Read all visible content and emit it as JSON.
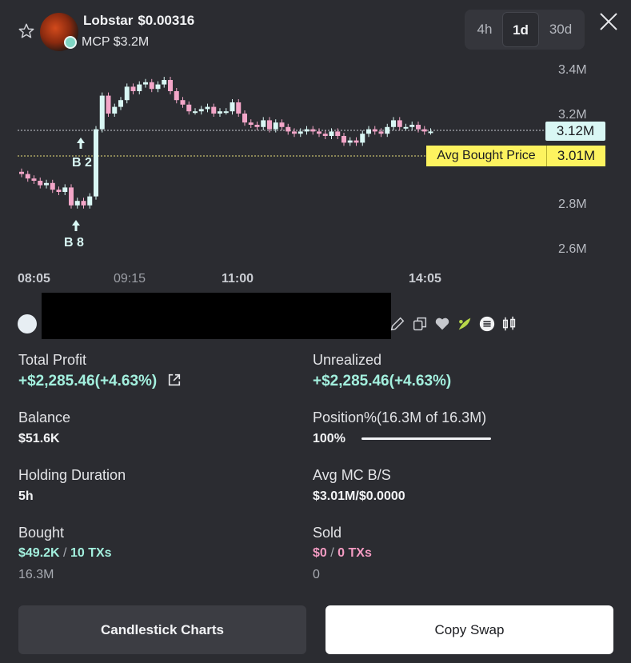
{
  "header": {
    "token_name": "Lobstar",
    "price": "$0.00316",
    "mcp": "MCP $3.2M",
    "timeframes": [
      "4h",
      "1d",
      "30d"
    ],
    "active_timeframe": "1d"
  },
  "chart_data": {
    "type": "candlestick",
    "y_ticks": [
      "3.4M",
      "3.2M",
      "2.8M",
      "2.6M"
    ],
    "x_ticks": [
      "08:05",
      "09:15",
      "11:00",
      "14:05"
    ],
    "current_price_label": "3.12M",
    "avg_bought_label": "Avg Bought Price",
    "avg_bought_value": "3.01M",
    "markers": [
      {
        "text": "B 8",
        "time": "08:55"
      },
      {
        "text": "B 2",
        "time": "09:00"
      }
    ],
    "up_color": "#d9f7f4",
    "down_color": "#f3a6c8",
    "closes_m": [
      2.93,
      2.91,
      2.9,
      2.88,
      2.89,
      2.86,
      2.85,
      2.87,
      2.79,
      2.81,
      2.79,
      2.83,
      3.13,
      3.28,
      3.2,
      3.23,
      3.26,
      3.32,
      3.3,
      3.33,
      3.34,
      3.31,
      3.33,
      3.35,
      3.3,
      3.26,
      3.24,
      3.21,
      3.21,
      3.22,
      3.23,
      3.2,
      3.21,
      3.21,
      3.25,
      3.2,
      3.16,
      3.15,
      3.14,
      3.17,
      3.13,
      3.16,
      3.14,
      3.12,
      3.11,
      3.12,
      3.13,
      3.12,
      3.11,
      3.1,
      3.12,
      3.1,
      3.07,
      3.08,
      3.07,
      3.11,
      3.13,
      3.12,
      3.11,
      3.14,
      3.17,
      3.14,
      3.14,
      3.15,
      3.13,
      3.12,
      3.12
    ]
  },
  "wallet": {
    "tools": [
      "edit-icon",
      "copy-icon",
      "heart-icon",
      "leaf-icon",
      "menu-icon",
      "candle-icon"
    ]
  },
  "stats": {
    "total_profit_label": "Total Profit",
    "total_profit_value": "+$2,285.46(+4.63%)",
    "unrealized_label": "Unrealized",
    "unrealized_value": "+$2,285.46(+4.63%)",
    "balance_label": "Balance",
    "balance_value": "$51.6K",
    "position_label": "Position%(16.3M of 16.3M)",
    "position_value": "100%",
    "position_fraction": 1.0,
    "holding_label": "Holding Duration",
    "holding_value": "5h",
    "avg_mc_label": "Avg MC B/S",
    "avg_mc_value": "$3.01M/$0.0000",
    "bought_label": "Bought",
    "bought_amount": "$49.2K",
    "bought_sep": "/",
    "bought_txs": "10 TXs",
    "bought_tokens": "16.3M",
    "sold_label": "Sold",
    "sold_amount": "$0",
    "sold_sep": "/",
    "sold_txs": "0 TXs",
    "sold_tokens": "0"
  },
  "actions": {
    "candlestick_label": "Candlestick Charts",
    "copy_swap_label": "Copy Swap"
  }
}
